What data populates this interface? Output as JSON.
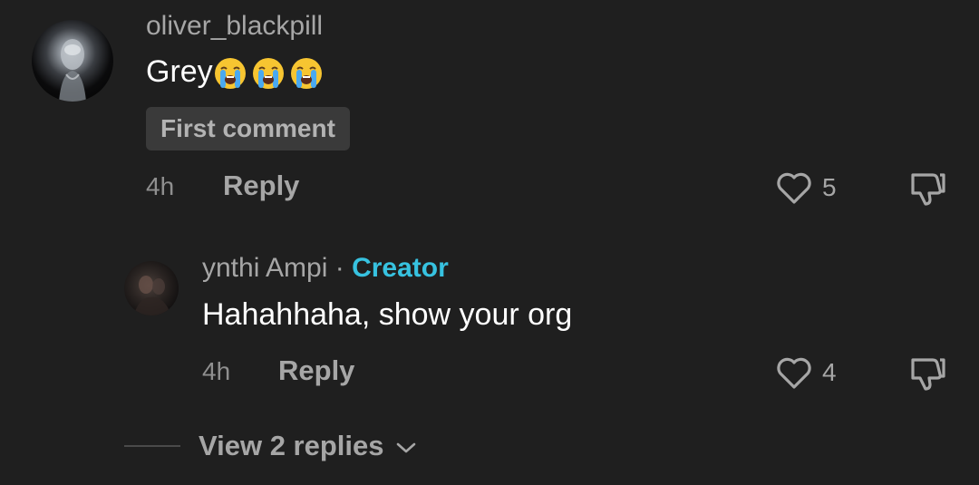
{
  "comment": {
    "username": "oliver_blackpill",
    "text": "Grey",
    "emojis": [
      "loudly-crying-face",
      "loudly-crying-face",
      "loudly-crying-face"
    ],
    "badge": "First comment",
    "time": "4h",
    "reply_label": "Reply",
    "likes": "5"
  },
  "reply": {
    "username": "ynthi Ampi",
    "separator": "·",
    "role": "Creator",
    "text": "Hahahhaha, show your org",
    "time": "4h",
    "reply_label": "Reply",
    "likes": "4"
  },
  "view_replies": {
    "label": "View 2 replies"
  },
  "colors": {
    "background": "#1f1f1f",
    "creator": "#37c2e0",
    "muted": "#a6a6a6",
    "badge_bg": "#3a3a3a"
  }
}
